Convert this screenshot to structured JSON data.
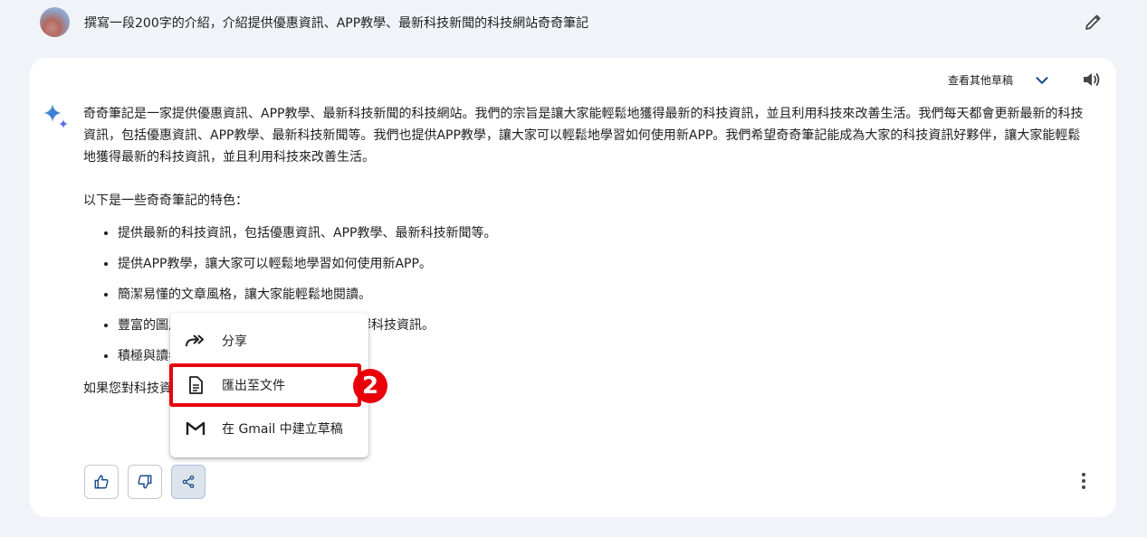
{
  "prompt": {
    "text": "撰寫一段200字的介紹，介紹提供優惠資訊、APP教學、最新科技新聞的科技網站奇奇筆記"
  },
  "response": {
    "view_drafts_label": "查看其他草稿",
    "paragraph1": "奇奇筆記是一家提供優惠資訊、APP教學、最新科技新聞的科技網站。我們的宗旨是讓大家能輕鬆地獲得最新的科技資訊，並且利用科技來改善生活。我們每天都會更新最新的科技資訊，包括優惠資訊、APP教學、最新科技新聞等。我們也提供APP教學，讓大家可以輕鬆地學習如何使用新APP。我們希望奇奇筆記能成為大家的科技資訊好夥伴，讓大家能輕鬆地獲得最新的科技資訊，並且利用科技來改善生活。",
    "paragraph2": "以下是一些奇奇筆記的特色：",
    "bullets": [
      "提供最新的科技資訊，包括優惠資訊、APP教學、最新科技新聞等。",
      "提供APP教學，讓大家可以輕鬆地學習如何使用新APP。",
      "簡潔易懂的文章風格，讓大家能輕鬆地閱讀。",
      "豐富的圖片和影片，讓大家可以更容易地了解科技資訊。",
      "積極與讀者互動，歡迎大家提出意見和建議。"
    ],
    "closing": "如果您對科技資訊有興趣，歡迎來奇奇筆記看看！"
  },
  "share_menu": {
    "items": [
      {
        "label": "分享",
        "icon": "share-arrow-icon"
      },
      {
        "label": "匯出至文件",
        "icon": "document-icon"
      },
      {
        "label": "在 Gmail 中建立草稿",
        "icon": "gmail-icon"
      }
    ]
  },
  "annotation": {
    "badge": "2",
    "color": "#e8000b"
  },
  "colors": {
    "page_bg": "#f0f4f9",
    "card_bg": "#ffffff",
    "accent_blue": "#1a4d8c"
  }
}
